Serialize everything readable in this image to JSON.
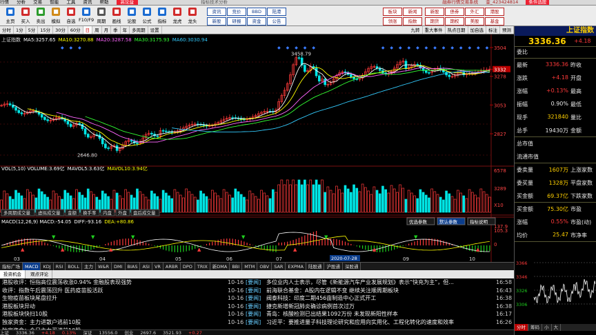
{
  "menubar": {
    "items": [
      "行情",
      "分析",
      "交易",
      "智能",
      "工具",
      "资讯",
      "帮助"
    ],
    "banner": "高论益",
    "center": "指标技术分析",
    "market_label": "融券行情交易系统",
    "account": "金_423424814",
    "quick_pick": "条件选股"
  },
  "toolbar": {
    "icons": [
      {
        "label": "主页",
        "icon": "home-icon",
        "color": "#1a6bd1"
      },
      {
        "label": "买入",
        "icon": "buy-icon",
        "color": "#d12b2b"
      },
      {
        "label": "卖出",
        "icon": "sell-icon",
        "color": "#2b9b2b"
      },
      {
        "label": "模拟",
        "icon": "sim-icon",
        "color": "#d18a1a"
      },
      {
        "label": "自选",
        "icon": "star-icon",
        "color": "#d12b2b"
      },
      {
        "label": "F10/F9",
        "icon": "f10-icon",
        "color": "#1a6bd1"
      },
      {
        "label": "周期",
        "icon": "period-icon",
        "color": "#555555"
      },
      {
        "label": "画线",
        "icon": "draw-icon",
        "color": "#d12b2b"
      },
      {
        "label": "论股",
        "icon": "chat-icon",
        "color": "#1a6bd1"
      },
      {
        "label": "公式",
        "icon": "formula-icon",
        "color": "#1a6bd1"
      },
      {
        "label": "指标",
        "icon": "indicator-icon",
        "color": "#1a6bd1"
      },
      {
        "label": "龙虎",
        "icon": "dragon-icon",
        "color": "#d12b2b"
      },
      {
        "label": "龙头",
        "icon": "leader-icon",
        "color": "#d12b2b"
      }
    ],
    "buttons_row1": [
      "资讯",
      "竞价",
      "BBD",
      "陆港"
    ],
    "buttons_row2": [
      "新股",
      "研报",
      "资金",
      "公告"
    ],
    "buttons2_row1": [
      "板块",
      "新闻"
    ],
    "buttons2_row2": [
      "领涨",
      "指数"
    ],
    "right_row1": [
      "新股",
      "债券",
      "外汇",
      "港股"
    ],
    "right_row2": [
      "期货",
      "期权",
      "美股",
      "基金"
    ]
  },
  "periods": {
    "items": [
      "分时",
      "1分",
      "5分",
      "15分",
      "30分",
      "60分",
      "日",
      "周",
      "月",
      "季",
      "年",
      "多周期",
      "设置"
    ],
    "active": "日",
    "right_items": [
      "九转",
      "重大事件",
      "热点日期",
      "加自选",
      "标注",
      "预测"
    ]
  },
  "chart": {
    "title": "上证指数",
    "ma_legend": [
      {
        "label": "MA5:",
        "value": "3257.65",
        "color": "#ffffff"
      },
      {
        "label": "MA10:",
        "value": "3270.88",
        "color": "#ffff00"
      },
      {
        "label": "MA20:",
        "value": "3287.58",
        "color": "#ff66ff"
      },
      {
        "label": "MA30:",
        "value": "3175.93",
        "color": "#33ff33"
      },
      {
        "label": "MA60:",
        "value": "3030.94",
        "color": "#33ccff"
      }
    ],
    "price_ticks": [
      "3504",
      "3332",
      "3278",
      "3053",
      "2827"
    ],
    "high_label": "3458.79",
    "low_label": "2646.80",
    "current_price_tag": "3332",
    "vol_legend": [
      {
        "label": "VOL(5,10) VOLUME:",
        "value": "3.69亿",
        "color": "#ffffff"
      },
      {
        "label": "MAVOL5:",
        "value": "3.63亿",
        "color": "#ffffff"
      },
      {
        "label": "MAVOL10:",
        "value": "3.94亿",
        "color": "#ffff00"
      }
    ],
    "vol_ticks": [
      "6578",
      "3289",
      "X10"
    ],
    "sub_tabs": [
      "多周期成交量",
      "虚拟成交量",
      "金额",
      "换手率",
      "内盘",
      "外盘",
      "盘后成交量"
    ],
    "macd_legend": [
      {
        "label": "MACD(12,26,9) MACD:",
        "value": "-54.05",
        "color": "#ffffff"
      },
      {
        "label": "DIFF:",
        "value": "-93.16",
        "color": "#ffffff"
      },
      {
        "label": "DEA:",
        "value": "+80.86",
        "color": "#ffff00"
      }
    ],
    "macd_ticks": [
      "137.9",
      "105.3",
      "0"
    ],
    "macd_buttons": [
      "优选参数",
      "默认参数",
      "指标说明"
    ],
    "x_labels": [
      "03",
      "04",
      "05",
      "06",
      "07",
      "08",
      "09",
      "10"
    ],
    "date_tag": "2020-07-28"
  },
  "bottomtabs": {
    "items": [
      "指标广场",
      "MACD",
      "KDJ",
      "RSI",
      "BOLL",
      "主力",
      "W&R",
      "DMI",
      "BIAS",
      "ASI",
      "VR",
      "ARBR",
      "DPO",
      "TRIX",
      "新DMA",
      "BBI",
      "MTM",
      "OBV",
      "SAR",
      "EXPMA",
      "陆股通",
      "沪股通",
      "深股通"
    ],
    "active": "MACD"
  },
  "newsbar": {
    "items": [
      "投资机会",
      "观点评论"
    ]
  },
  "news_left": [
    "港股收评：恒指高位震荡收涨0.94% 金融股表现强势",
    "收评：指数午后震荡回升 医药疫苗股活跃",
    "生物疫苗板块尾盘拉升",
    "港股板块异动",
    "港股板块快扫10股",
    "独家资金：主力进散户逃前10股",
    "独家资金：今日主力买进前10股"
  ],
  "news_right": [
    {
      "date": "10-16",
      "tag": "[要闻]",
      "headline": "多位业内人士表示，尽管《新能源汽车产业发展规划》表示“快充为主”，但...",
      "time": "16:58"
    },
    {
      "date": "10-16",
      "tag": "[要闻]",
      "headline": "前海联合基金：A股内在逻辑不变 继续关注顺周期板块",
      "time": "16:43"
    },
    {
      "date": "10-16",
      "tag": "[要闻]",
      "headline": "阀泰科技：印度二期456亩制造中心正式开工",
      "time": "16:38"
    },
    {
      "date": "10-16",
      "tag": "[要闻]",
      "headline": "捷克新增新冠肺炎确诊病例首次过万",
      "time": "16:38"
    },
    {
      "date": "10-16",
      "tag": "[要闻]",
      "headline": "青岛：核酸检测已出结果1092万份 未发现新阳性样本",
      "time": "16:17"
    },
    {
      "date": "10-16",
      "tag": "[要闻]",
      "headline": "习近平：要推进量子科技理论研究和应用向实用化、工程化转化的速度和效率",
      "time": "16:26"
    }
  ],
  "statusbar": {
    "items": [
      "上证",
      "3336.36",
      "+4.18",
      "0.13%",
      "深证",
      "13556.0",
      "创业",
      "2697.6",
      "3521.93",
      "+0.27"
    ]
  },
  "quote": {
    "title": "上证指数",
    "price": "3336.36",
    "change": "+4.18",
    "rows": [
      {
        "l": "委比",
        "v": "",
        "l2": "",
        "v2": ""
      },
      {
        "l": "最新",
        "v": "3336.36",
        "vc": "red",
        "l2": "昨收",
        "v2": ""
      },
      {
        "l": "涨跌",
        "v": "+4.18",
        "vc": "red",
        "l2": "开盘",
        "v2": ""
      },
      {
        "l": "涨幅",
        "v": "+0.13%",
        "vc": "red",
        "l2": "最高",
        "v2": ""
      },
      {
        "l": "振幅",
        "v": "0.90%",
        "vc": "wht",
        "l2": "最低",
        "v2": ""
      },
      {
        "l": "现手",
        "v": "321840",
        "vc": "yel",
        "l2": "量比",
        "v2": ""
      },
      {
        "l": "总手",
        "v": "19430万",
        "vc": "wht",
        "l2": "金额",
        "v2": ""
      },
      {
        "l": "总市值",
        "v": "",
        "vc": "wht",
        "l2": "",
        "v2": ""
      },
      {
        "l": "流通市值",
        "v": "",
        "vc": "wht",
        "l2": "",
        "v2": ""
      },
      {
        "l": "委卖量",
        "v": "1607万",
        "vc": "yel",
        "l2": "上涨家数",
        "v2": ""
      },
      {
        "l": "委买量",
        "v": "1328万",
        "vc": "yel",
        "l2": "平盘家数",
        "v2": ""
      },
      {
        "l": "买金额",
        "v": "69.37亿",
        "vc": "yel",
        "l2": "下跌家数",
        "v2": ""
      },
      {
        "l": "买金额",
        "v": "75.30亿",
        "vc": "yel",
        "l2": "市盈",
        "v2": ""
      },
      {
        "l": "涨幅",
        "v": "0.55%",
        "vc": "red",
        "l2": "市盈(动)",
        "v2": ""
      },
      {
        "l": "均价",
        "v": "25.47",
        "vc": "yel",
        "l2": "市净率",
        "v2": ""
      }
    ],
    "mini_ticks": [
      "3366",
      "3346",
      "3326",
      "3306"
    ],
    "tabs": [
      "分时",
      "筹码",
      "小",
      "大"
    ]
  },
  "colors": {
    "up": "#ff3a3a",
    "down": "#1fd01f",
    "accent": "#ffd000",
    "panel": "#0a1a5a"
  }
}
